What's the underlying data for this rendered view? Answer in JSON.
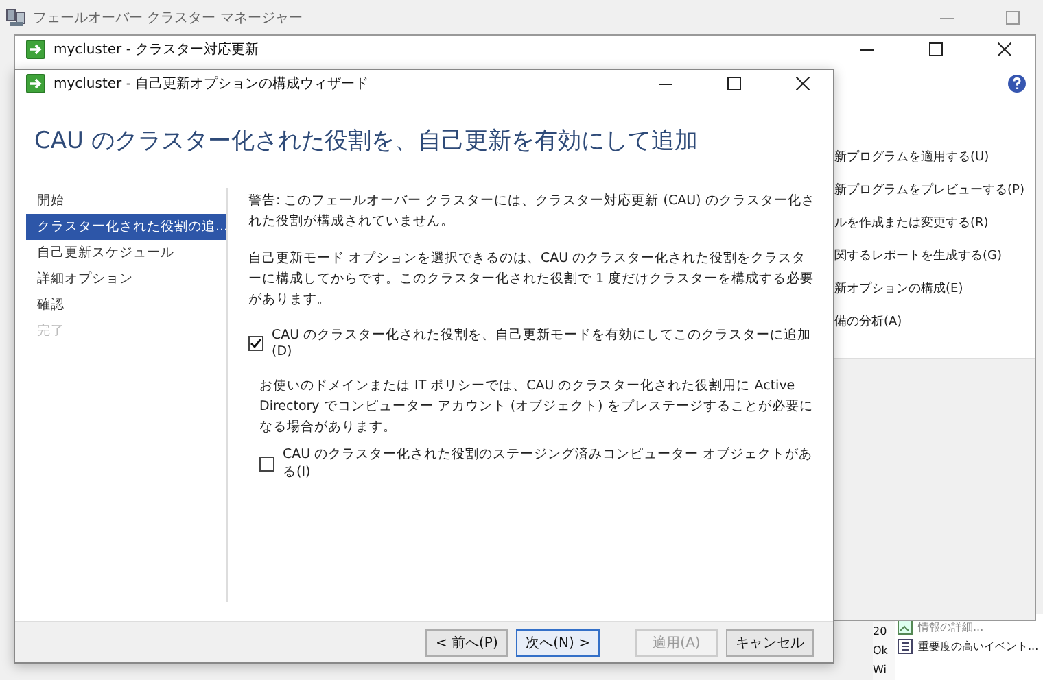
{
  "background_window": {
    "title": "フェールオーバー クラスター マネージャー",
    "column_cells": [
      "20",
      "Ok",
      "Wi"
    ],
    "actions": [
      {
        "label": "情報の詳細...",
        "disabled": true
      },
      {
        "label": "重要度の高いイベント...",
        "disabled": false
      }
    ]
  },
  "cau_window": {
    "title": "mycluster - クラスター対応更新",
    "actions": [
      "新プログラムを適用する(U)",
      "新プログラムをプレビューする(P)",
      "ルを作成または変更する(R)",
      "関するレポートを生成する(G)",
      "新オプションの構成(E)",
      "備の分析(A)"
    ]
  },
  "wizard": {
    "title": "mycluster - 自己更新オプションの構成ウィザード",
    "heading": "CAU のクラスター化された役割を、自己更新を有効にして追加",
    "steps": [
      {
        "label": "開始",
        "selected": false,
        "disabled": false
      },
      {
        "label": "クラスター化された役割の追...",
        "selected": true,
        "disabled": false
      },
      {
        "label": "自己更新スケジュール",
        "selected": false,
        "disabled": false
      },
      {
        "label": "詳細オプション",
        "selected": false,
        "disabled": false
      },
      {
        "label": "確認",
        "selected": false,
        "disabled": false
      },
      {
        "label": "完了",
        "selected": false,
        "disabled": true
      }
    ],
    "content": [
      {
        "kind": "paragraph",
        "text": "警告: このフェールオーバー クラスターには、クラスター対応更新 (CAU) のクラスター化された役割が構成されていません。"
      },
      {
        "kind": "paragraph",
        "text": "自己更新モード オプションを選択できるのは、CAU のクラスター化された役割をクラスターに構成してからです。このクラスター化された役割で 1 度だけクラスターを構成する必要があります。"
      },
      {
        "kind": "checkbox",
        "text": "CAU のクラスター化された役割を、自己更新モードを有効にしてこのクラスターに追加(D)",
        "checked": true
      },
      {
        "kind": "note",
        "text": "お使いのドメインまたは IT ポリシーでは、CAU のクラスター化された役割用に Active Directory でコンピューター アカウント (オブジェクト) をプレステージすることが必要になる場合があります。"
      },
      {
        "kind": "subcheckbox",
        "text": "CAU のクラスター化された役割のステージング済みコンピューター オブジェクトがある(I)",
        "checked": false
      }
    ],
    "buttons": [
      {
        "label": "< 前へ(P)",
        "default": false,
        "disabled": false
      },
      {
        "label": "次へ(N) >",
        "default": true,
        "disabled": false
      },
      {
        "label": "適用(A)",
        "default": false,
        "disabled": true
      },
      {
        "label": "キャンセル",
        "default": false,
        "disabled": false
      }
    ]
  }
}
